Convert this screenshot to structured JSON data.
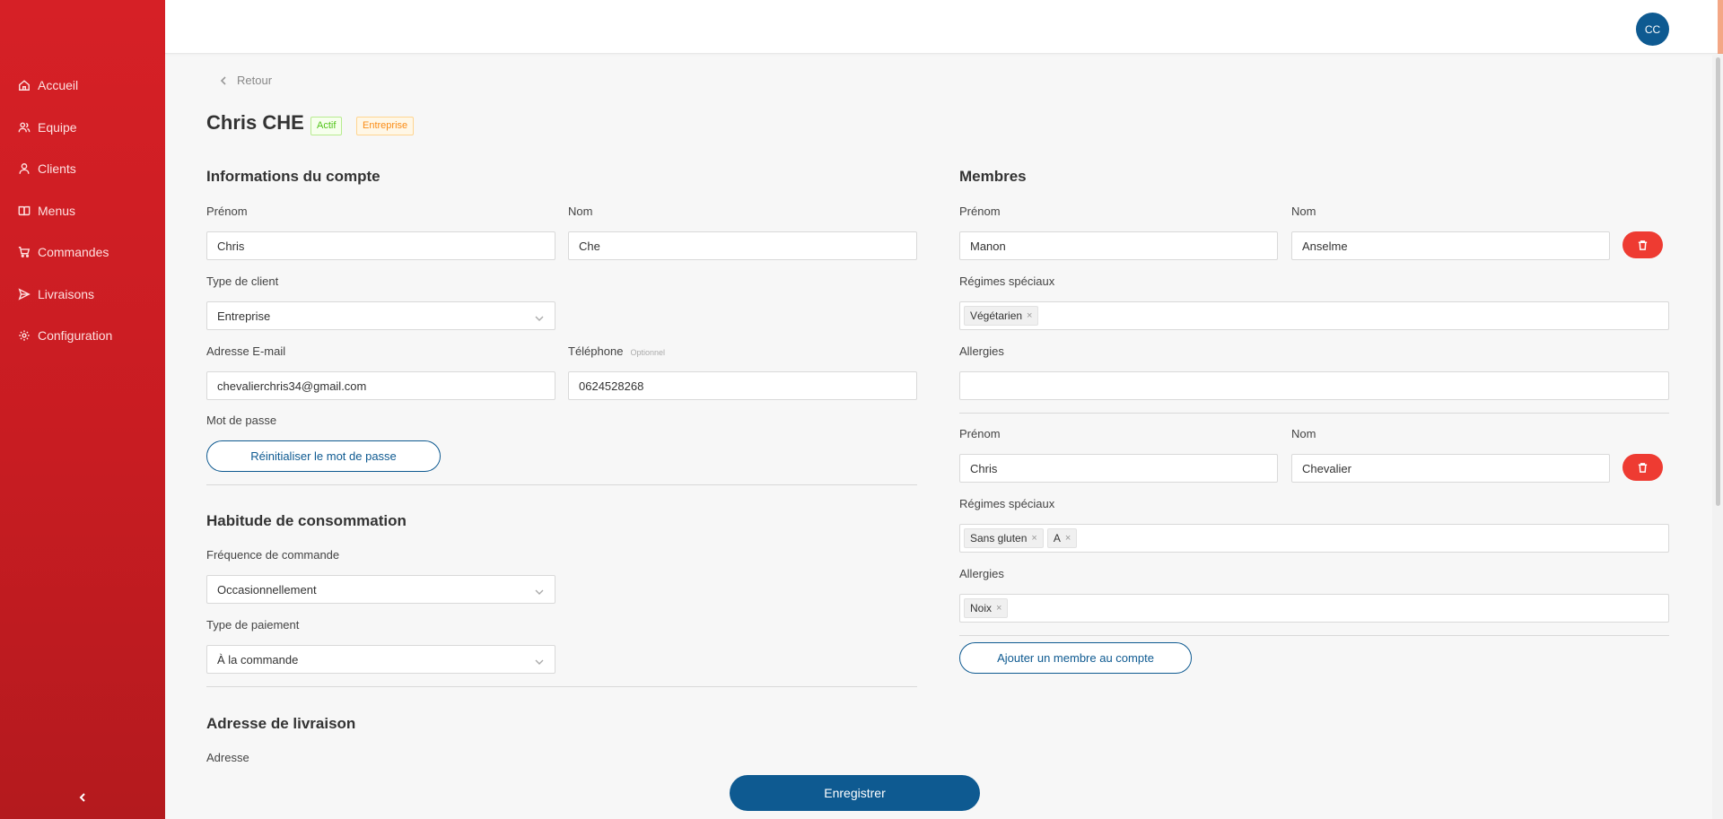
{
  "sidebar": {
    "items": [
      {
        "label": "Accueil"
      },
      {
        "label": "Equipe"
      },
      {
        "label": "Clients"
      },
      {
        "label": "Menus"
      },
      {
        "label": "Commandes"
      },
      {
        "label": "Livraisons"
      },
      {
        "label": "Configuration"
      }
    ]
  },
  "header": {
    "avatar_initials": "CC"
  },
  "page": {
    "back_label": "Retour",
    "title": "Chris CHE",
    "tags": [
      "Actif",
      "Entreprise"
    ]
  },
  "account": {
    "section_title": "Informations du compte",
    "firstname_label": "Prénom",
    "firstname": "Chris",
    "lastname_label": "Nom",
    "lastname": "Che",
    "client_type_label": "Type de client",
    "client_type": "Entreprise",
    "email_label": "Adresse E-mail",
    "email": "chevalierchris34@gmail.com",
    "phone_label": "Téléphone",
    "phone_optional": "Optionnel",
    "phone": "0624528268",
    "password_label": "Mot de passe",
    "reset_password_button": "Réinitialiser le mot de passe"
  },
  "habits": {
    "section_title": "Habitude de consommation",
    "frequency_label": "Fréquence de commande",
    "frequency": "Occasionnellement",
    "payment_label": "Type de paiement",
    "payment": "À la commande"
  },
  "delivery": {
    "section_title": "Adresse de livraison",
    "address_label": "Adresse"
  },
  "members": {
    "section_title": "Membres",
    "firstname_label": "Prénom",
    "lastname_label": "Nom",
    "diets_label": "Régimes spéciaux",
    "allergies_label": "Allergies",
    "list": [
      {
        "firstname": "Manon",
        "lastname": "Anselme",
        "diets": [
          "Végétarien"
        ],
        "allergies": []
      },
      {
        "firstname": "Chris",
        "lastname": "Chevalier",
        "diets": [
          "Sans gluten",
          "A"
        ],
        "allergies": [
          "Noix"
        ]
      }
    ],
    "add_member_button": "Ajouter un membre au compte"
  },
  "save_button": "Enregistrer",
  "colors": {
    "sidebar": "#d62026",
    "primary": "#0e5a91",
    "danger": "#ee3b32",
    "tag_actif": "#52c41a",
    "tag_entreprise": "#fa8c16"
  }
}
